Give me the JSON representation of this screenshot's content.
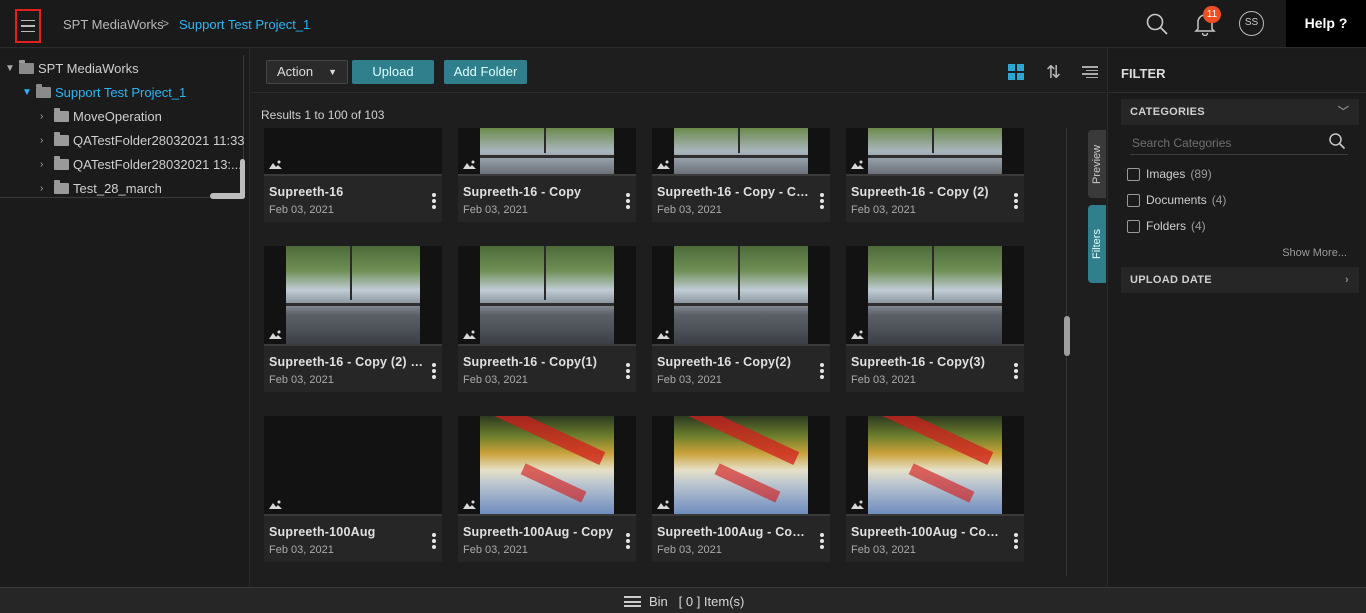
{
  "header": {
    "breadcrumb_root": "SPT MediaWorks",
    "breadcrumb_sep": ">",
    "breadcrumb_current": "Support Test Project_1",
    "notification_count": "11",
    "avatar_initials": "SS",
    "help_label": "Help ?"
  },
  "tree": {
    "items": [
      {
        "label": "SPT MediaWorks",
        "level": 0,
        "expanded": true
      },
      {
        "label": "Support Test Project_1",
        "level": 1,
        "expanded": true,
        "selected": true
      },
      {
        "label": "MoveOperation",
        "level": 2
      },
      {
        "label": "QATestFolder28032021 11:33",
        "level": 2
      },
      {
        "label": "QATestFolder28032021 13:...",
        "level": 2
      },
      {
        "label": "Test_28_march",
        "level": 2
      }
    ]
  },
  "toolbar": {
    "action_label": "Action",
    "upload_label": "Upload",
    "add_folder_label": "Add Folder"
  },
  "results_text": "Results 1 to 100 of 103",
  "assets": [
    {
      "title": "Supreeth-16",
      "date": "Feb 03, 2021",
      "thumb": "dark"
    },
    {
      "title": "Supreeth-16 - Copy",
      "date": "Feb 03, 2021",
      "thumb": "lake"
    },
    {
      "title": "Supreeth-16 - Copy - Cop...",
      "date": "Feb 03, 2021",
      "thumb": "lake"
    },
    {
      "title": "Supreeth-16 - Copy (2)",
      "date": "Feb 03, 2021",
      "thumb": "lake"
    },
    {
      "title": "Supreeth-16 - Copy (2) - ...",
      "date": "Feb 03, 2021",
      "thumb": "lake"
    },
    {
      "title": "Supreeth-16 - Copy(1)",
      "date": "Feb 03, 2021",
      "thumb": "lake"
    },
    {
      "title": "Supreeth-16 - Copy(2)",
      "date": "Feb 03, 2021",
      "thumb": "lake"
    },
    {
      "title": "Supreeth-16 - Copy(3)",
      "date": "Feb 03, 2021",
      "thumb": "lake"
    },
    {
      "title": "Supreeth-100Aug",
      "date": "Feb 03, 2021",
      "thumb": "dark"
    },
    {
      "title": "Supreeth-100Aug - Copy",
      "date": "Feb 03, 2021",
      "thumb": "autumn"
    },
    {
      "title": "Supreeth-100Aug - Copy ...",
      "date": "Feb 03, 2021",
      "thumb": "autumn"
    },
    {
      "title": "Supreeth-100Aug - Copy ...",
      "date": "Feb 03, 2021",
      "thumb": "autumn"
    }
  ],
  "side_tabs": {
    "preview": "Preview",
    "filters": "Filters"
  },
  "filter": {
    "title": "FILTER",
    "categories_label": "CATEGORIES",
    "search_placeholder": "Search Categories",
    "categories": [
      {
        "label": "Images",
        "count": "(89)"
      },
      {
        "label": "Documents",
        "count": "(4)"
      },
      {
        "label": "Folders",
        "count": "(4)"
      }
    ],
    "show_more": "Show More...",
    "upload_date_label": "UPLOAD DATE"
  },
  "bottom": {
    "bin_label": "Bin",
    "bin_count": "[ 0 ] Item(s)"
  },
  "colors": {
    "accent": "#29b6f6",
    "teal_button": "#2f7f8c",
    "highlight_border": "#e0211f",
    "badge": "#f04e23"
  }
}
